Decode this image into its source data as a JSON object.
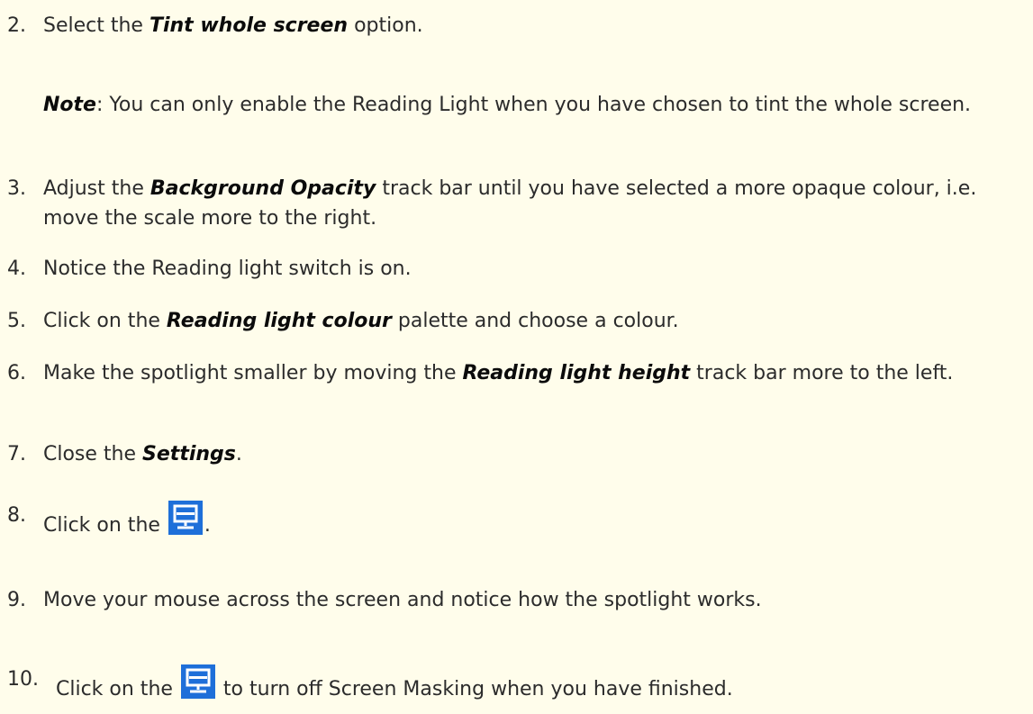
{
  "steps": [
    {
      "num": "2.",
      "before": "Select the ",
      "em": "Tint whole screen",
      "after": " option."
    },
    {
      "note_label": "Note",
      "note_text": ":  You can only enable the Reading Light when you have chosen to tint the whole screen."
    },
    {
      "num": "3.",
      "before": "Adjust the ",
      "em": "Background Opacity",
      "after": " track bar until you have selected a more opaque colour, i.e. move the scale more to the right."
    },
    {
      "num": "4.",
      "text": "Notice the Reading light switch is on."
    },
    {
      "num": "5.",
      "before": "Click on the ",
      "em": "Reading light colour",
      "after": " palette and choose a colour."
    },
    {
      "num": "6.",
      "before": "Make the spotlight smaller by moving the ",
      "em": "Reading light height",
      "after": " track bar more to the left."
    },
    {
      "num": "7.",
      "before": "Close the ",
      "em": "Settings",
      "after": "."
    },
    {
      "num": "8.",
      "before": "Click on the ",
      "after": "."
    },
    {
      "num": "9.",
      "text": "Move your mouse across the screen and notice how the spotlight works."
    },
    {
      "num": "10.",
      "before": "Click on the ",
      "after": " to turn off Screen Masking when you have finished."
    }
  ],
  "icons": {
    "screen_mask_icon": "screen-masking-icon",
    "icon_color": "#1e6fd9"
  }
}
